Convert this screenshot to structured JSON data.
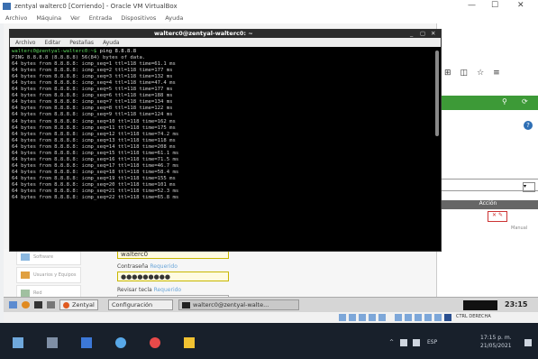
{
  "host": {
    "title": "zentyal walterc0 [Corriendo] - Oracle VM VirtualBox",
    "menu": [
      "Archivo",
      "Máquina",
      "Ver",
      "Entrada",
      "Dispositivos",
      "Ayuda"
    ],
    "controls": [
      "—",
      "☐",
      "✕"
    ]
  },
  "terminal": {
    "title": "walterc0@zentyal-walterc0: ~",
    "window_controls": [
      "_",
      "▢",
      "✕"
    ],
    "menu": [
      "Archivo",
      "Editar",
      "Pestañas",
      "Ayuda"
    ],
    "prompt": "walterc0@zentyal-walterc0:~$",
    "command": " ping 8.8.8.8",
    "header": "PING 8.8.8.8 (8.8.8.8) 56(84) bytes of data.",
    "replies": [
      "64 bytes from 8.8.8.8: icmp_seq=1 ttl=118 time=61.1 ms",
      "64 bytes from 8.8.8.8: icmp_seq=2 ttl=118 time=177 ms",
      "64 bytes from 8.8.8.8: icmp_seq=3 ttl=118 time=132 ms",
      "64 bytes from 8.8.8.8: icmp_seq=4 ttl=118 time=47.4 ms",
      "64 bytes from 8.8.8.8: icmp_seq=5 ttl=118 time=177 ms",
      "64 bytes from 8.8.8.8: icmp_seq=6 ttl=118 time=188 ms",
      "64 bytes from 8.8.8.8: icmp_seq=7 ttl=118 time=134 ms",
      "64 bytes from 8.8.8.8: icmp_seq=8 ttl=118 time=122 ms",
      "64 bytes from 8.8.8.8: icmp_seq=9 ttl=118 time=124 ms",
      "64 bytes from 8.8.8.8: icmp_seq=10 ttl=118 time=162 ms",
      "64 bytes from 8.8.8.8: icmp_seq=11 ttl=118 time=175 ms",
      "64 bytes from 8.8.8.8: icmp_seq=12 ttl=118 time=74.2 ms",
      "64 bytes from 8.8.8.8: icmp_seq=13 ttl=118 time=118 ms",
      "64 bytes from 8.8.8.8: icmp_seq=14 ttl=118 time=208 ms",
      "64 bytes from 8.8.8.8: icmp_seq=15 ttl=118 time=61.1 ms",
      "64 bytes from 8.8.8.8: icmp_seq=16 ttl=118 time=71.5 ms",
      "64 bytes from 8.8.8.8: icmp_seq=17 ttl=118 time=46.7 ms",
      "64 bytes from 8.8.8.8: icmp_seq=18 ttl=118 time=58.4 ms",
      "64 bytes from 8.8.8.8: icmp_seq=19 ttl=118 time=155 ms",
      "64 bytes from 8.8.8.8: icmp_seq=20 ttl=118 time=101 ms",
      "64 bytes from 8.8.8.8: icmp_seq=21 ttl=118 time=52.3 ms",
      "64 bytes from 8.8.8.8: icmp_seq=22 ttl=118 time=65.8 ms"
    ]
  },
  "browser": {
    "green_icons": [
      "⚲",
      "⟳"
    ],
    "toolbar_icons": [
      "⊞",
      "◫",
      "☆",
      "≡"
    ],
    "help": "?",
    "table_header": "Acción",
    "row_action": "Manual",
    "edit_button": "✕ ✎",
    "field_button": "▾"
  },
  "form": {
    "sidebar": [
      "Software",
      "Usuarios y Equipos",
      "Red"
    ],
    "username_value": "walterc0",
    "password_label": "Contraseña",
    "password_hint": "Requerido",
    "password_value": "●●●●●●●●●",
    "repeat_label": "Revisar tecla",
    "repeat_hint": "Requerido"
  },
  "guest_taskbar": {
    "apps": [
      "Zentyal",
      "Configuración",
      "walterc0@zentyal-walte..."
    ],
    "clock": "23:15"
  },
  "vbox_status": {
    "host_key": "CTRL DERECHA"
  },
  "win_taskbar": {
    "language": "ESP",
    "time": "17:15 p. m.",
    "date": "21/05/2021"
  }
}
